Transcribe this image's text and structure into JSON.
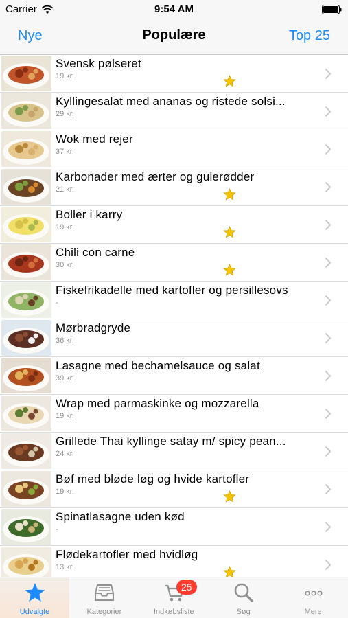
{
  "status_bar": {
    "carrier": "Carrier",
    "time": "9:54 AM"
  },
  "nav": {
    "left_button": "Nye",
    "title": "Populære",
    "right_button": "Top 25"
  },
  "colors": {
    "accent": "#1a8cff",
    "badge": "#ff3b30",
    "star": "#f5c400"
  },
  "recipes": [
    {
      "title": "Svensk pølseret",
      "price": "19 kr.",
      "starred": true
    },
    {
      "title": "Kyllingesalat med ananas og ristede solsi...",
      "price": "29 kr.",
      "starred": false
    },
    {
      "title": "Wok med rejer",
      "price": "37 kr.",
      "starred": false
    },
    {
      "title": "Karbonader med ærter og gulerødder",
      "price": "21 kr.",
      "starred": true
    },
    {
      "title": "Boller i karry",
      "price": "19 kr.",
      "starred": true
    },
    {
      "title": "Chili con carne",
      "price": "30 kr.",
      "starred": true
    },
    {
      "title": "Fiskefrikadelle med kartofler og persillesovs",
      "price": "-",
      "starred": false
    },
    {
      "title": "Mørbradgryde",
      "price": "36 kr.",
      "starred": false
    },
    {
      "title": "Lasagne med bechamelsauce og salat",
      "price": "39 kr.",
      "starred": false
    },
    {
      "title": "Wrap med parmaskinke og mozzarella",
      "price": "19 kr.",
      "starred": false
    },
    {
      "title": "Grillede Thai kyllinge satay m/ spicy pean...",
      "price": "24 kr.",
      "starred": false
    },
    {
      "title": "Bøf med bløde løg og hvide kartofler",
      "price": "19 kr.",
      "starred": true
    },
    {
      "title": "Spinatlasagne uden kød",
      "price": "-",
      "starred": false
    },
    {
      "title": "Flødekartofler med hvidløg",
      "price": "13 kr.",
      "starred": true
    }
  ],
  "tabs": [
    {
      "label": "Udvalgte",
      "icon": "star-icon",
      "active": true
    },
    {
      "label": "Kategorier",
      "icon": "tray-icon",
      "active": false
    },
    {
      "label": "Indkøbsliste",
      "icon": "cart-icon",
      "active": false,
      "badge": "25"
    },
    {
      "label": "Søg",
      "icon": "search-icon",
      "active": false
    },
    {
      "label": "Mere",
      "icon": "more-icon",
      "active": false
    }
  ]
}
